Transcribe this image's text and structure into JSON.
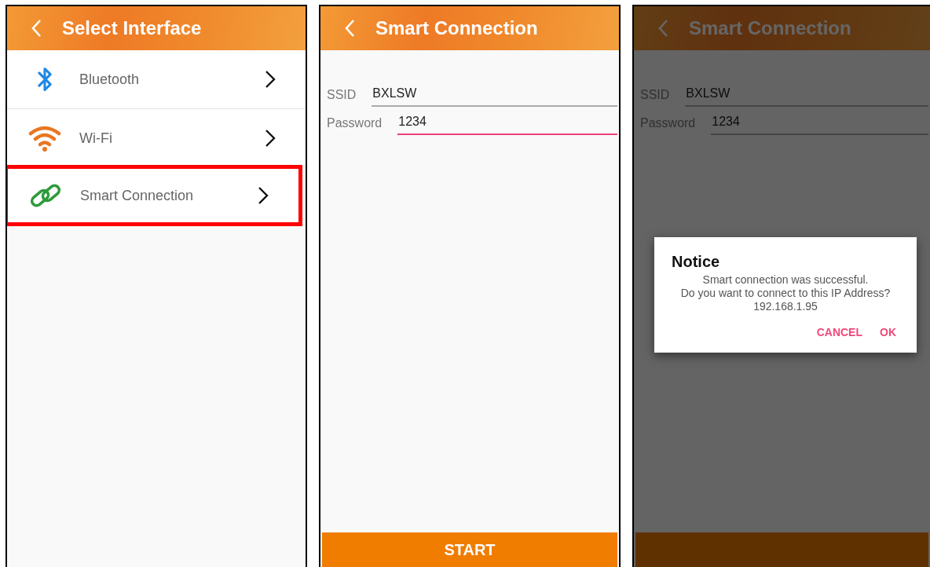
{
  "screens": [
    {
      "kind": "list",
      "title": "Select Interface",
      "dimmed": false,
      "items": [
        {
          "label": "Bluetooth",
          "highlighted": false
        },
        {
          "label": "Wi-Fi",
          "highlighted": false
        },
        {
          "label": "Smart Connection",
          "highlighted": true
        }
      ]
    },
    {
      "kind": "form",
      "title": "Smart Connection",
      "dimmed": false,
      "fields": [
        {
          "label": "SSID",
          "value": "BXLSW",
          "focused": false
        },
        {
          "label": "Password",
          "value": "1234",
          "focused": true
        }
      ],
      "button": "START"
    },
    {
      "kind": "form",
      "title": "Smart Connection",
      "dimmed": true,
      "fields": [
        {
          "label": "SSID",
          "value": "BXLSW",
          "focused": false
        },
        {
          "label": "Password",
          "value": "1234",
          "focused": false
        }
      ],
      "dialog": {
        "title": "Notice",
        "message": [
          "Smart connection was successful.",
          "Do you want to connect to this IP Address?",
          "192.168.1.95"
        ],
        "actions": [
          "CANCEL",
          "OK"
        ]
      }
    }
  ]
}
